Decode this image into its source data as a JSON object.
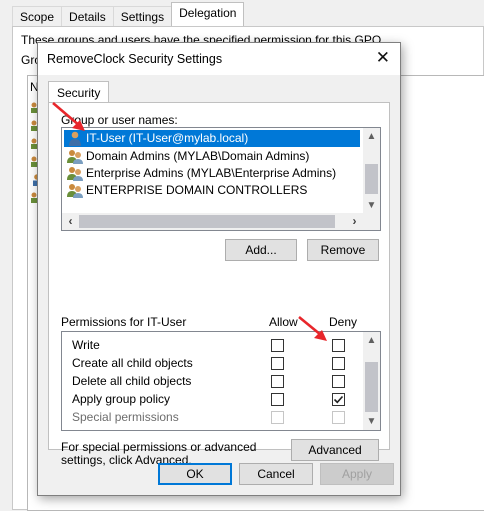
{
  "background_window": {
    "tabs": [
      "Scope",
      "Details",
      "Settings",
      "Delegation"
    ],
    "active_tab": "Delegation",
    "description": "These groups and users have the specified permission for this GPO",
    "group_label_fragment": "Grou",
    "list_header_fragment": "Na"
  },
  "dialog": {
    "title": "RemoveClock Security Settings",
    "close_glyph": "✕",
    "tab": "Security",
    "group_label": "Group or user names:",
    "names": [
      {
        "label": "IT-User (IT-User@mylab.local)",
        "icon": "single-user-icon",
        "selected": true
      },
      {
        "label": "Domain Admins (MYLAB\\Domain Admins)",
        "icon": "user-group-icon",
        "selected": false
      },
      {
        "label": "Enterprise Admins (MYLAB\\Enterprise Admins)",
        "icon": "user-group-icon",
        "selected": false
      },
      {
        "label": "ENTERPRISE DOMAIN CONTROLLERS",
        "icon": "user-group-icon",
        "selected": false
      }
    ],
    "add_button": "Add...",
    "remove_button": "Remove",
    "permissions_label": "Permissions for IT-User",
    "allow_header": "Allow",
    "deny_header": "Deny",
    "permissions": [
      {
        "name": "Write",
        "allow": false,
        "deny": false,
        "enabled": true
      },
      {
        "name": "Create all child objects",
        "allow": false,
        "deny": false,
        "enabled": true
      },
      {
        "name": "Delete all child objects",
        "allow": false,
        "deny": false,
        "enabled": true
      },
      {
        "name": "Apply group policy",
        "allow": false,
        "deny": true,
        "enabled": true
      },
      {
        "name": "Special permissions",
        "allow": false,
        "deny": false,
        "enabled": false
      }
    ],
    "special_text": "For special permissions or advanced settings, click Advanced.",
    "advanced_button": "Advanced",
    "ok_button": "OK",
    "cancel_button": "Cancel",
    "apply_button": "Apply"
  },
  "colors": {
    "selection": "#0078d7",
    "annotation_arrow": "#e8262b",
    "dialog_bg": "#f0f0f0"
  }
}
